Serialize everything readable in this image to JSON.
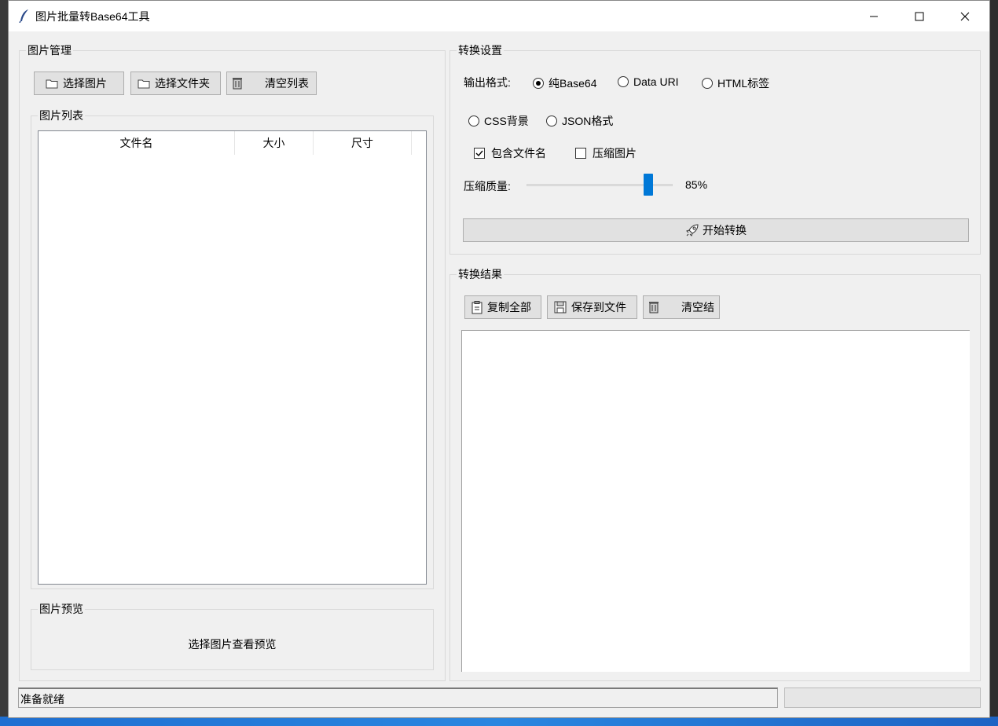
{
  "window": {
    "title": "图片批量转Base64工具"
  },
  "left": {
    "group_title": "图片管理",
    "buttons": {
      "select_images": "选择图片",
      "select_folder": "选择文件夹",
      "clear_list": "清空列表"
    },
    "list_group_title": "图片列表",
    "columns": [
      "文件名",
      "大小",
      "尺寸"
    ],
    "preview_group_title": "图片预览",
    "preview_placeholder": "选择图片查看预览"
  },
  "settings": {
    "group_title": "转换设置",
    "output_format_label": "输出格式:",
    "formats": [
      "纯Base64",
      "Data URI",
      "HTML标签",
      "CSS背景",
      "JSON格式"
    ],
    "selected_format": "纯Base64",
    "include_filename": {
      "label": "包含文件名",
      "checked": true
    },
    "compress_image": {
      "label": "压缩图片",
      "checked": false
    },
    "quality_label": "压缩质量:",
    "quality_value": 85,
    "quality_text": "85%",
    "start_button": "开始转换"
  },
  "result": {
    "group_title": "转换结果",
    "buttons": {
      "copy_all": "复制全部",
      "save_to_file": "保存到文件",
      "clear_result": "清空结"
    }
  },
  "status": {
    "text": "准备就绪"
  },
  "colors": {
    "accent": "#0078d7"
  }
}
